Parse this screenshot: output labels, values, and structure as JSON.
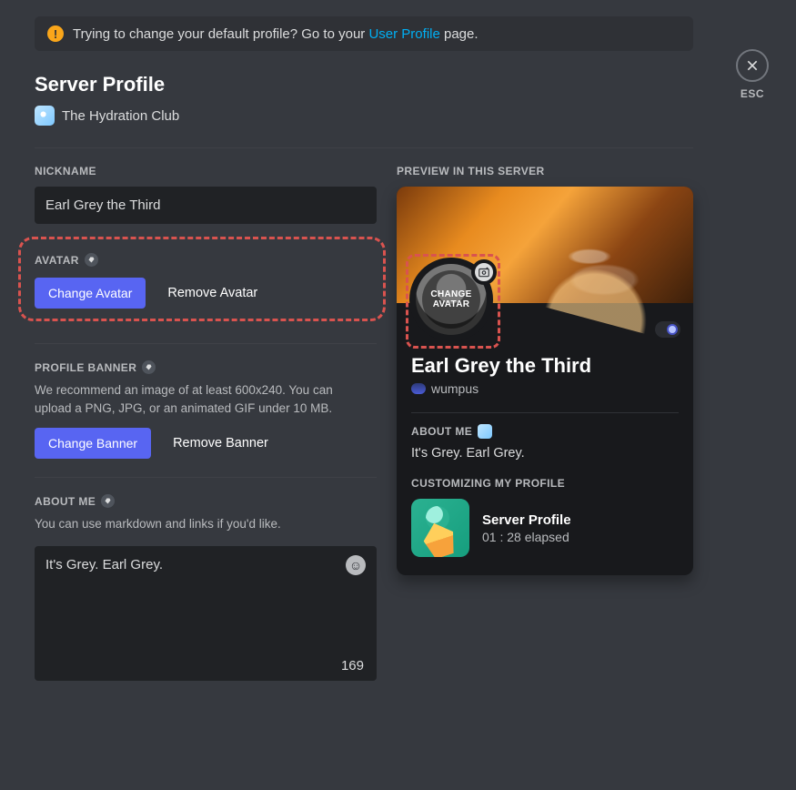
{
  "notice": {
    "text_before": "Trying to change your default profile? Go to your ",
    "link_text": "User Profile",
    "text_after": " page."
  },
  "close": {
    "esc": "ESC"
  },
  "title": "Server Profile",
  "server": {
    "name": "The Hydration Club"
  },
  "nickname": {
    "label": "Nickname",
    "value": "Earl Grey the Third"
  },
  "avatar": {
    "label": "Avatar",
    "change": "Change Avatar",
    "remove": "Remove Avatar"
  },
  "banner": {
    "label": "Profile Banner",
    "helper": "We recommend an image of at least 600x240. You can upload a PNG, JPG, or an animated GIF under 10 MB.",
    "change": "Change Banner",
    "remove": "Remove Banner"
  },
  "about": {
    "label": "About Me",
    "helper": "You can use markdown and links if you'd like.",
    "value": "It's Grey. Earl Grey.",
    "count": "169"
  },
  "preview": {
    "label": "Preview in this server",
    "change_avatar_overlay": "CHANGE AVATAR",
    "display_name": "Earl Grey the Third",
    "handle": "wumpus",
    "about_label": "ABOUT ME",
    "about_text": "It's Grey. Earl Grey.",
    "activity_label": "CUSTOMIZING MY PROFILE",
    "activity_title": "Server Profile",
    "activity_elapsed": "01 : 28 elapsed"
  }
}
